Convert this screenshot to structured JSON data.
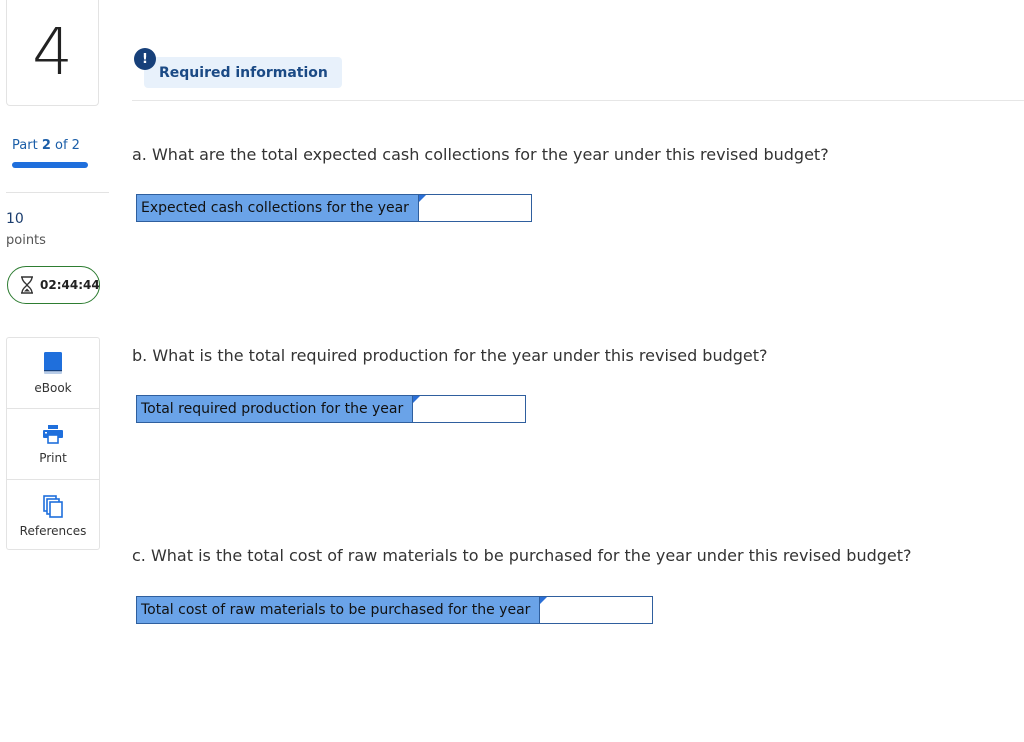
{
  "sidebar": {
    "question_number": "4",
    "part_prefix": "Part",
    "part_current": "2",
    "part_of": "of 2",
    "progress_fraction": 1.0,
    "points_value": "10",
    "points_label": "points",
    "timer": "02:44:44",
    "tools": [
      {
        "label": "eBook",
        "icon": "book-icon"
      },
      {
        "label": "Print",
        "icon": "printer-icon"
      },
      {
        "label": "References",
        "icon": "copy-pages-icon"
      }
    ]
  },
  "header": {
    "badge": "!",
    "title": "Required information"
  },
  "questions": [
    {
      "prompt": "a. What are the total expected cash collections for the year under this revised budget?",
      "label": "Expected cash collections for the year",
      "value": ""
    },
    {
      "prompt": "b. What is the total required production for the year under this revised budget?",
      "label": "Total required production for the year",
      "value": ""
    },
    {
      "prompt": "c. What is the total cost of raw materials to be purchased for the year under this revised budget?",
      "label": "Total cost of raw materials to be purchased for the year",
      "value": ""
    }
  ],
  "colors": {
    "accent": "#1f6fdc",
    "label_fill": "#6aa3e8",
    "timer_border": "#2e7d32",
    "badge": "#17407a"
  }
}
